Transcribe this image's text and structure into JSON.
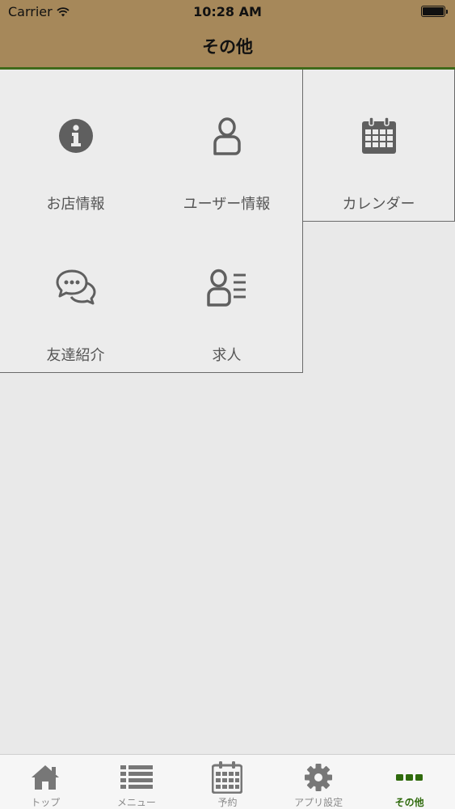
{
  "status_bar": {
    "carrier": "Carrier",
    "time": "10:28 AM"
  },
  "header": {
    "title": "その他"
  },
  "grid": {
    "items": [
      {
        "label": "お店情報",
        "icon": "info-circle-icon"
      },
      {
        "label": "ユーザー情報",
        "icon": "user-icon"
      },
      {
        "label": "カレンダー",
        "icon": "calendar-icon"
      },
      {
        "label": "友達紹介",
        "icon": "chat-bubbles-icon"
      },
      {
        "label": "求人",
        "icon": "user-list-icon"
      }
    ]
  },
  "tabbar": {
    "tabs": [
      {
        "label": "トップ",
        "icon": "home-icon"
      },
      {
        "label": "メニュー",
        "icon": "list-icon"
      },
      {
        "label": "予約",
        "icon": "calendar-icon"
      },
      {
        "label": "アプリ設定",
        "icon": "gear-icon"
      },
      {
        "label": "その他",
        "icon": "more-dots-icon",
        "active": true
      }
    ]
  },
  "colors": {
    "header_bg": "#a6885a",
    "header_border": "#3f6a1a",
    "active_tab": "#2f6a0c",
    "icon_gray": "#5f5f5f"
  }
}
